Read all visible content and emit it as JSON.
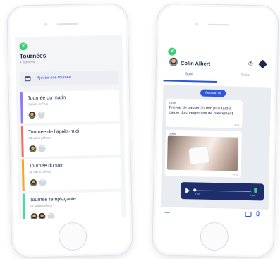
{
  "left_app": {
    "title": "Tournées",
    "subtitle": "4 tournées",
    "add_label": "Ajouter une tournée",
    "tours": [
      {
        "name": "Tournée du matin",
        "count": "8 soins prévus",
        "color": "#8f7cf0",
        "avatars": 1
      },
      {
        "name": "Tournée de l'après-midi",
        "count": "38 soins prévus",
        "color": "#f26b6b",
        "avatars": 1
      },
      {
        "name": "Tournée du soir",
        "count": "38 soins prévus",
        "color": "#f5a524",
        "avatars": 1
      },
      {
        "name": "Tournée remplaçante",
        "count": "20 soins prévus",
        "color": "#4dd6a8",
        "avatars": 2
      }
    ]
  },
  "right_app": {
    "contact_name": "Colin Albert",
    "tabs": {
      "active": "Suivi",
      "other": "Soins"
    },
    "date_pill": "Aujourd'hui",
    "message": {
      "author": "Leslie",
      "text": "Prévoir de passer 30 min plus tard à cause du changement de pansement",
      "time": "8:41"
    },
    "photo_message": {
      "author": "Leslie",
      "time": "8:43"
    },
    "audio": {
      "elapsed": "0:00",
      "duration": "1:14"
    },
    "icons": {
      "call": "phone-icon",
      "navigate": "navigation-icon",
      "play": "play-icon",
      "camera": "camera-icon",
      "mic": "mic-icon"
    }
  }
}
